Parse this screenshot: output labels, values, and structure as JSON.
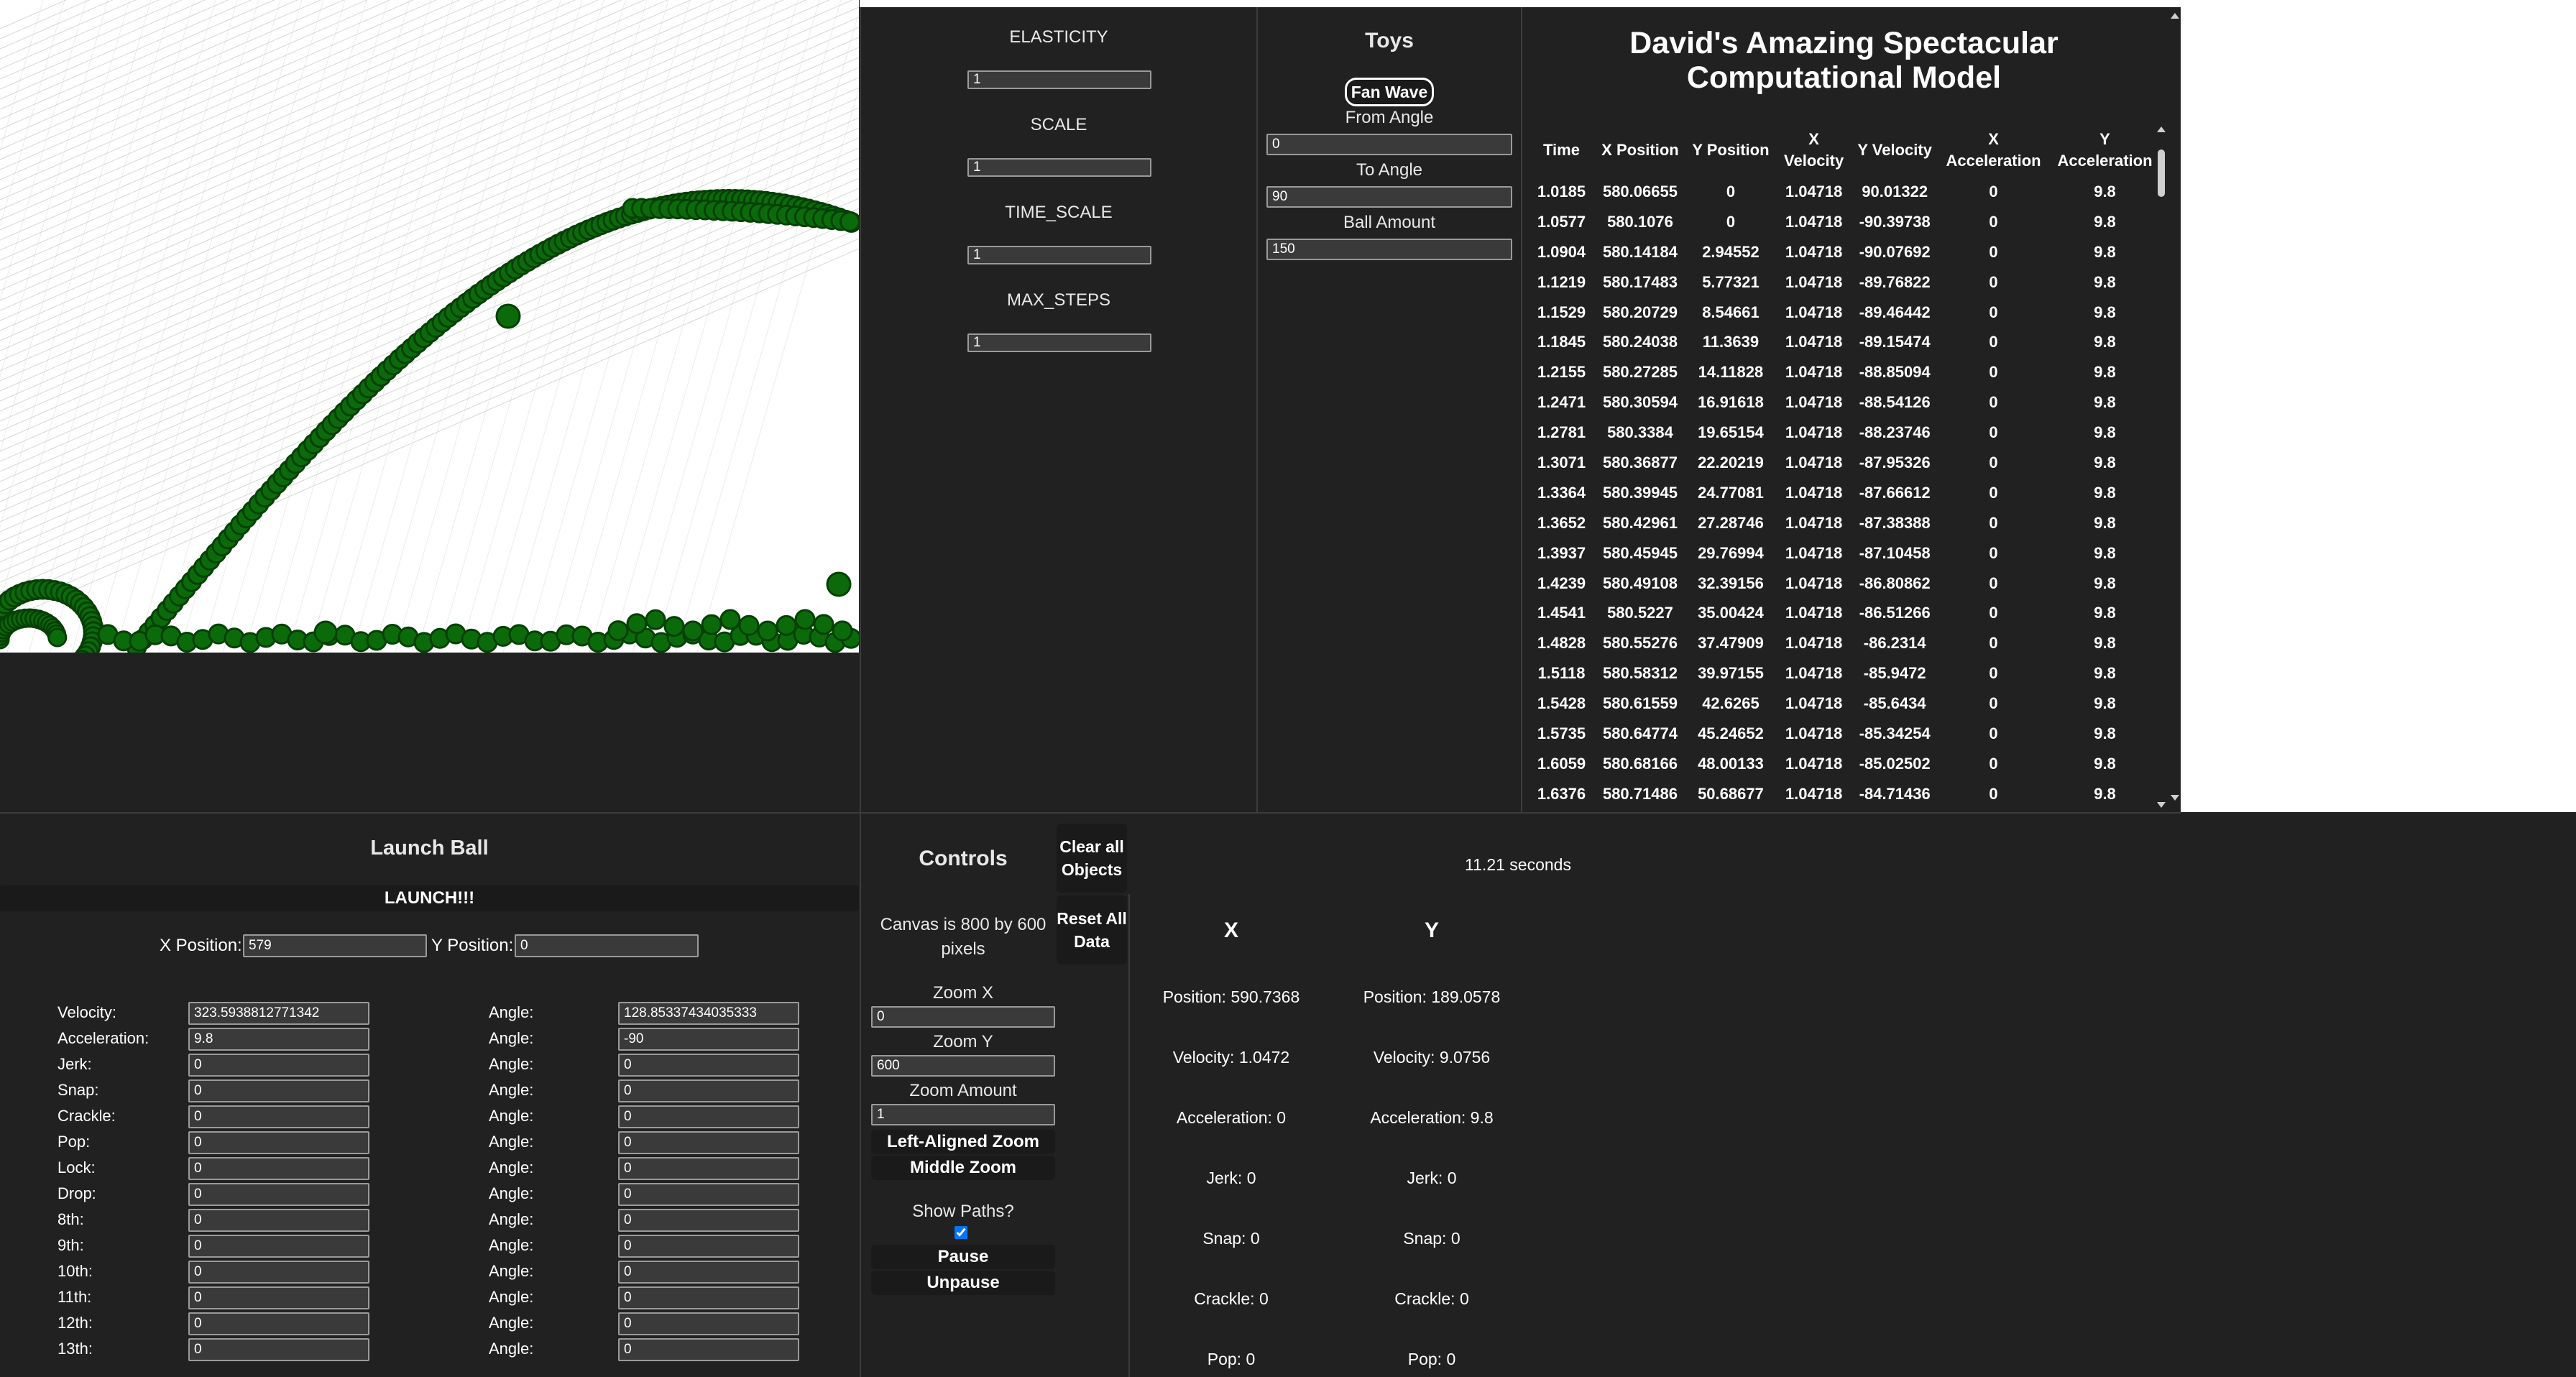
{
  "params": {
    "elasticity_label": "ELASTICITY",
    "elasticity_value": "1",
    "scale_label": "SCALE",
    "scale_value": "1",
    "time_scale_label": "TIME_SCALE",
    "time_scale_value": "1",
    "max_steps_label": "MAX_STEPS",
    "max_steps_value": "1"
  },
  "toys": {
    "title": "Toys",
    "fan_wave_label": "Fan Wave",
    "from_angle_label": "From Angle",
    "from_angle_value": "0",
    "to_angle_label": "To Angle",
    "to_angle_value": "90",
    "ball_amount_label": "Ball Amount",
    "ball_amount_value": "150"
  },
  "model": {
    "title_line1": "David's Amazing Spectacular",
    "title_line2": "Computational Model",
    "columns": [
      "Time",
      "X Position",
      "Y Position",
      "X Velocity",
      "Y Velocity",
      "X Acceleration",
      "Y Acceleration"
    ],
    "rows": [
      [
        "1.0185",
        "580.06655",
        "0",
        "1.04718",
        "90.01322",
        "0",
        "9.8"
      ],
      [
        "1.0577",
        "580.1076",
        "0",
        "1.04718",
        "-90.39738",
        "0",
        "9.8"
      ],
      [
        "1.0904",
        "580.14184",
        "2.94552",
        "1.04718",
        "-90.07692",
        "0",
        "9.8"
      ],
      [
        "1.1219",
        "580.17483",
        "5.77321",
        "1.04718",
        "-89.76822",
        "0",
        "9.8"
      ],
      [
        "1.1529",
        "580.20729",
        "8.54661",
        "1.04718",
        "-89.46442",
        "0",
        "9.8"
      ],
      [
        "1.1845",
        "580.24038",
        "11.3639",
        "1.04718",
        "-89.15474",
        "0",
        "9.8"
      ],
      [
        "1.2155",
        "580.27285",
        "14.11828",
        "1.04718",
        "-88.85094",
        "0",
        "9.8"
      ],
      [
        "1.2471",
        "580.30594",
        "16.91618",
        "1.04718",
        "-88.54126",
        "0",
        "9.8"
      ],
      [
        "1.2781",
        "580.3384",
        "19.65154",
        "1.04718",
        "-88.23746",
        "0",
        "9.8"
      ],
      [
        "1.3071",
        "580.36877",
        "22.20219",
        "1.04718",
        "-87.95326",
        "0",
        "9.8"
      ],
      [
        "1.3364",
        "580.39945",
        "24.77081",
        "1.04718",
        "-87.66612",
        "0",
        "9.8"
      ],
      [
        "1.3652",
        "580.42961",
        "27.28746",
        "1.04718",
        "-87.38388",
        "0",
        "9.8"
      ],
      [
        "1.3937",
        "580.45945",
        "29.76994",
        "1.04718",
        "-87.10458",
        "0",
        "9.8"
      ],
      [
        "1.4239",
        "580.49108",
        "32.39156",
        "1.04718",
        "-86.80862",
        "0",
        "9.8"
      ],
      [
        "1.4541",
        "580.5227",
        "35.00424",
        "1.04718",
        "-86.51266",
        "0",
        "9.8"
      ],
      [
        "1.4828",
        "580.55276",
        "37.47909",
        "1.04718",
        "-86.2314",
        "0",
        "9.8"
      ],
      [
        "1.5118",
        "580.58312",
        "39.97155",
        "1.04718",
        "-85.9472",
        "0",
        "9.8"
      ],
      [
        "1.5428",
        "580.61559",
        "42.6265",
        "1.04718",
        "-85.6434",
        "0",
        "9.8"
      ],
      [
        "1.5735",
        "580.64774",
        "45.24652",
        "1.04718",
        "-85.34254",
        "0",
        "9.8"
      ],
      [
        "1.6059",
        "580.68166",
        "48.00133",
        "1.04718",
        "-85.02502",
        "0",
        "9.8"
      ],
      [
        "1.6376",
        "580.71486",
        "50.68677",
        "1.04718",
        "-84.71436",
        "0",
        "9.8"
      ]
    ]
  },
  "launch": {
    "title": "Launch Ball",
    "launch_button": "LAUNCH!!!",
    "x_pos_label": "X Position:",
    "x_pos_value": "579",
    "y_pos_label": "Y Position:",
    "y_pos_value": "0",
    "angle_label": "Angle:",
    "derivatives": [
      {
        "label": "Velocity:",
        "value": "323.5938812771342",
        "angle": "128.85337434035333"
      },
      {
        "label": "Acceleration:",
        "value": "9.8",
        "angle": "-90"
      },
      {
        "label": "Jerk:",
        "value": "0",
        "angle": "0"
      },
      {
        "label": "Snap:",
        "value": "0",
        "angle": "0"
      },
      {
        "label": "Crackle:",
        "value": "0",
        "angle": "0"
      },
      {
        "label": "Pop:",
        "value": "0",
        "angle": "0"
      },
      {
        "label": "Lock:",
        "value": "0",
        "angle": "0"
      },
      {
        "label": "Drop:",
        "value": "0",
        "angle": "0"
      },
      {
        "label": "8th:",
        "value": "0",
        "angle": "0"
      },
      {
        "label": "9th:",
        "value": "0",
        "angle": "0"
      },
      {
        "label": "10th:",
        "value": "0",
        "angle": "0"
      },
      {
        "label": "11th:",
        "value": "0",
        "angle": "0"
      },
      {
        "label": "12th:",
        "value": "0",
        "angle": "0"
      },
      {
        "label": "13th:",
        "value": "0",
        "angle": "0"
      }
    ]
  },
  "controls": {
    "title": "Controls",
    "clear_all_button": "Clear all Objects",
    "reset_button": "Reset All Data",
    "canvas_info": "Canvas is 800 by 600 pixels",
    "zoom_x_label": "Zoom X",
    "zoom_x_value": "0",
    "zoom_y_label": "Zoom Y",
    "zoom_y_value": "600",
    "zoom_amount_label": "Zoom Amount",
    "zoom_amount_value": "1",
    "left_zoom_button": "Left-Aligned Zoom",
    "middle_zoom_button": "Middle Zoom",
    "show_paths_label": "Show Paths?",
    "show_paths_checked": true,
    "pause_button": "Pause",
    "unpause_button": "Unpause"
  },
  "stats": {
    "timer": "11.21 seconds",
    "x_header": "X",
    "y_header": "Y",
    "x": [
      "Position: 590.7368",
      "Velocity: 1.0472",
      "Acceleration: 0",
      "Jerk: 0",
      "Snap: 0",
      "Crackle: 0",
      "Pop: 0"
    ],
    "y": [
      "Position: 189.0578",
      "Velocity: 9.0756",
      "Acceleration: 9.8",
      "Jerk: 0",
      "Snap: 0",
      "Crackle: 0",
      "Pop: 0"
    ]
  },
  "colors": {
    "background": "#212121",
    "ball": "#0b6b0b",
    "ball_outline": "#054005",
    "canvas": "#ffffff"
  }
}
